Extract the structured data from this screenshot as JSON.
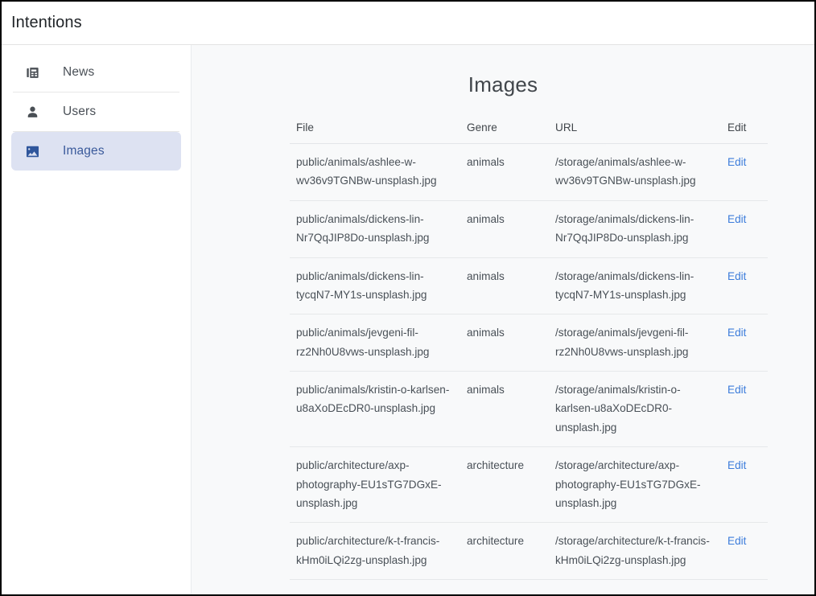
{
  "header": {
    "title": "Intentions"
  },
  "sidebar": {
    "items": [
      {
        "label": "News",
        "icon": "newspaper-icon",
        "active": false
      },
      {
        "label": "Users",
        "icon": "person-icon",
        "active": false
      },
      {
        "label": "Images",
        "icon": "image-icon",
        "active": true
      }
    ]
  },
  "main": {
    "title": "Images",
    "table": {
      "columns": [
        "File",
        "Genre",
        "URL",
        "Edit"
      ],
      "edit_label": "Edit",
      "rows": [
        {
          "file": "public/animals/ashlee-w-wv36v9TGNBw-unsplash.jpg",
          "genre": "animals",
          "url": "/storage/animals/ashlee-w-wv36v9TGNBw-unsplash.jpg",
          "edit": "Edit"
        },
        {
          "file": "public/animals/dickens-lin-Nr7QqJIP8Do-unsplash.jpg",
          "genre": "animals",
          "url": "/storage/animals/dickens-lin-Nr7QqJIP8Do-unsplash.jpg",
          "edit": "Edit"
        },
        {
          "file": "public/animals/dickens-lin-tycqN7-MY1s-unsplash.jpg",
          "genre": "animals",
          "url": "/storage/animals/dickens-lin-tycqN7-MY1s-unsplash.jpg",
          "edit": "Edit"
        },
        {
          "file": "public/animals/jevgeni-fil-rz2Nh0U8vws-unsplash.jpg",
          "genre": "animals",
          "url": "/storage/animals/jevgeni-fil-rz2Nh0U8vws-unsplash.jpg",
          "edit": "Edit"
        },
        {
          "file": "public/animals/kristin-o-karlsen-u8aXoDEcDR0-unsplash.jpg",
          "genre": "animals",
          "url": "/storage/animals/kristin-o-karlsen-u8aXoDEcDR0-unsplash.jpg",
          "edit": "Edit"
        },
        {
          "file": "public/architecture/axp-photography-EU1sTG7DGxE-unsplash.jpg",
          "genre": "architecture",
          "url": "/storage/architecture/axp-photography-EU1sTG7DGxE-unsplash.jpg",
          "edit": "Edit"
        },
        {
          "file": "public/architecture/k-t-francis-kHm0iLQi2zg-unsplash.jpg",
          "genre": "architecture",
          "url": "/storage/architecture/k-t-francis-kHm0iLQi2zg-unsplash.jpg",
          "edit": "Edit"
        }
      ]
    }
  },
  "colors": {
    "accent_link": "#3d7ddb",
    "active_nav_bg": "#dde2f2",
    "active_nav_text": "#3a5a9b",
    "content_bg": "#f8f9fa"
  }
}
